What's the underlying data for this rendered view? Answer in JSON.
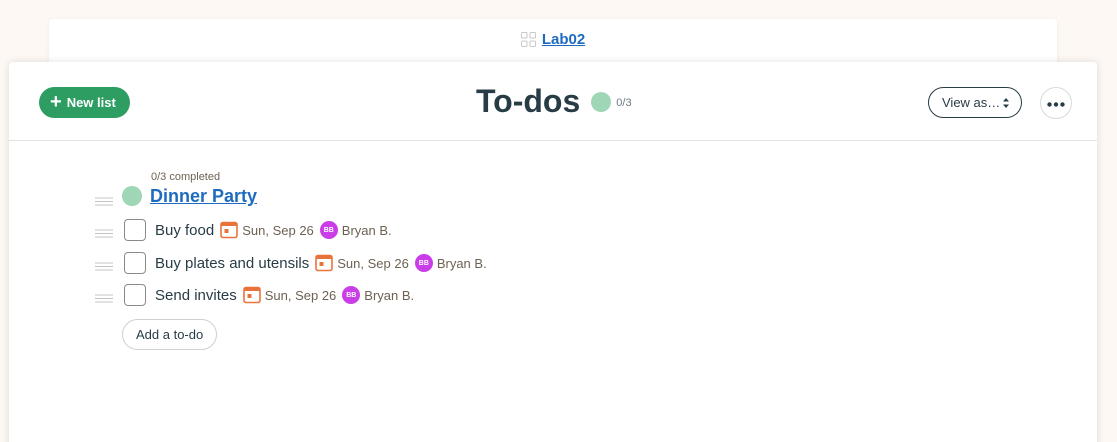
{
  "breadcrumb": {
    "project": "Lab02",
    "icon": "grid-icon"
  },
  "header": {
    "new_list_label": "New list",
    "title": "To-dos",
    "progress": "0/3",
    "view_as_label": "View as…",
    "more_icon": "ellipsis-icon"
  },
  "list": {
    "completed_label": "0/3 completed",
    "title": "Dinner Party",
    "todos": [
      {
        "text": "Buy food",
        "due": "Sun, Sep 26",
        "avatar": "BB",
        "assignee": "Bryan B."
      },
      {
        "text": "Buy plates and utensils",
        "due": "Sun, Sep 26",
        "avatar": "BB",
        "assignee": "Bryan B."
      },
      {
        "text": "Send invites",
        "due": "Sun, Sep 26",
        "avatar": "BB",
        "assignee": "Bryan B."
      }
    ],
    "add_todo_label": "Add a to-do"
  },
  "colors": {
    "accent_green": "#2d9d62",
    "progress_green": "#9ed6b6",
    "link_blue": "#1e6bc0",
    "avatar_purple": "#c93ee6",
    "calendar_orange": "#e8743b"
  }
}
